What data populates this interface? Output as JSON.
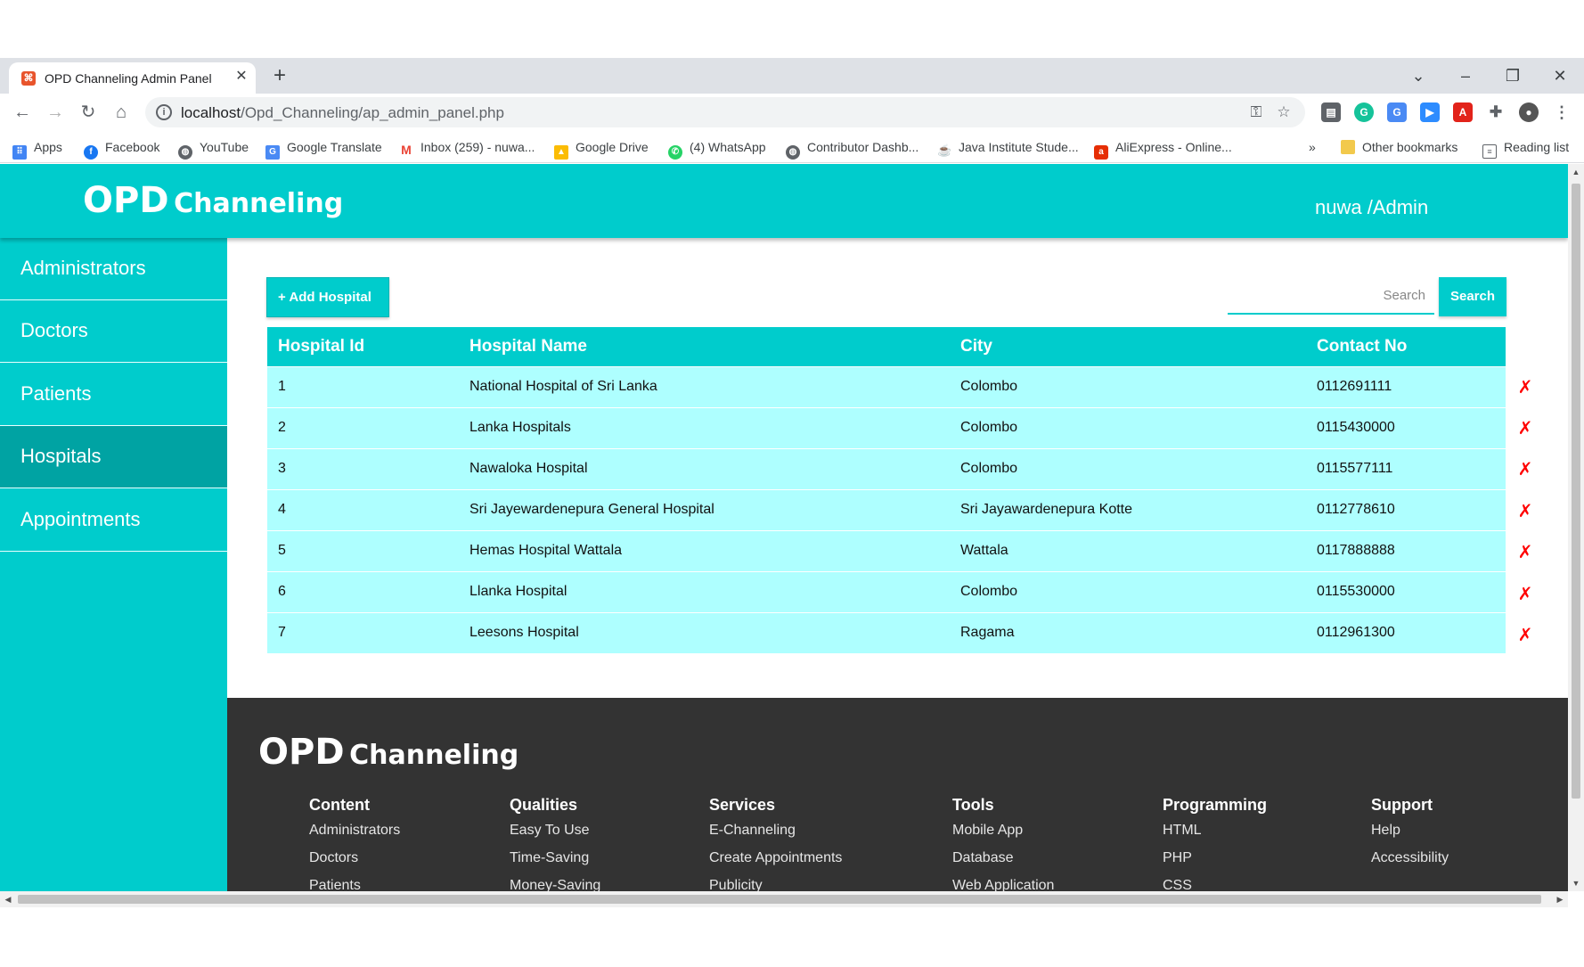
{
  "browser": {
    "tab_title": "OPD Channeling Admin Panel",
    "tab_close": "✕",
    "new_tab": "+",
    "url_host": "localhost",
    "url_path": "/Opd_Channeling/ap_admin_panel.php",
    "bookmarks": [
      {
        "label": "Apps",
        "icon": "apps-icon"
      },
      {
        "label": "Facebook",
        "icon": "facebook-icon"
      },
      {
        "label": "YouTube",
        "icon": "globe-icon"
      },
      {
        "label": "Google Translate",
        "icon": "translate-icon"
      },
      {
        "label": "Inbox (259) - nuwa...",
        "icon": "gmail-icon"
      },
      {
        "label": "Google Drive",
        "icon": "drive-icon"
      },
      {
        "label": "(4) WhatsApp",
        "icon": "whatsapp-icon"
      },
      {
        "label": "Contributor Dashb...",
        "icon": "globe-icon"
      },
      {
        "label": "Java Institute Stude...",
        "icon": "java-icon"
      },
      {
        "label": "AliExpress - Online...",
        "icon": "aliexpress-icon"
      }
    ],
    "more_bookmarks": "»",
    "other_bookmarks": "Other bookmarks",
    "reading_list": "Reading list"
  },
  "header": {
    "brand_main": "OPD",
    "brand_sub": "Channeling",
    "user": "nuwa /Admin"
  },
  "sidebar": {
    "items": [
      {
        "label": "Administrators",
        "active": false
      },
      {
        "label": "Doctors",
        "active": false
      },
      {
        "label": "Patients",
        "active": false
      },
      {
        "label": "Hospitals",
        "active": true
      },
      {
        "label": "Appointments",
        "active": false
      }
    ]
  },
  "main": {
    "add_button": "+ Add Hospital",
    "search_placeholder": "Search",
    "search_button": "Search",
    "delete_symbol": "✗",
    "columns": [
      "Hospital Id",
      "Hospital Name",
      "City",
      "Contact No"
    ],
    "rows": [
      {
        "id": "1",
        "name": "National Hospital of Sri Lanka",
        "city": "Colombo",
        "contact": "0112691111"
      },
      {
        "id": "2",
        "name": "Lanka Hospitals",
        "city": "Colombo",
        "contact": "0115430000"
      },
      {
        "id": "3",
        "name": "Nawaloka Hospital",
        "city": "Colombo",
        "contact": "0115577111"
      },
      {
        "id": "4",
        "name": "Sri Jayewardenepura General Hospital",
        "city": "Sri Jayawardenepura Kotte",
        "contact": "0112778610"
      },
      {
        "id": "5",
        "name": "Hemas Hospital Wattala",
        "city": "Wattala",
        "contact": "0117888888"
      },
      {
        "id": "6",
        "name": "Llanka Hospital",
        "city": "Colombo",
        "contact": "0115530000"
      },
      {
        "id": "7",
        "name": "Leesons Hospital",
        "city": "Ragama",
        "contact": "0112961300"
      }
    ]
  },
  "footer": {
    "brand_main": "OPD",
    "brand_sub": "Channeling",
    "columns": [
      {
        "heading": "Content",
        "links": [
          "Administrators",
          "Doctors",
          "Patients"
        ]
      },
      {
        "heading": "Qualities",
        "links": [
          "Easy To Use",
          "Time-Saving",
          "Money-Saving"
        ]
      },
      {
        "heading": "Services",
        "links": [
          "E-Channeling",
          "Create Appointments",
          "Publicity"
        ]
      },
      {
        "heading": "Tools",
        "links": [
          "Mobile App",
          "Database",
          "Web Application"
        ]
      },
      {
        "heading": "Programming",
        "links": [
          "HTML",
          "PHP",
          "CSS"
        ]
      },
      {
        "heading": "Support",
        "links": [
          "Help",
          "Accessibility"
        ]
      }
    ]
  },
  "colors": {
    "primary": "#00cccc",
    "active_nav": "#00a3a3",
    "row_bg": "#aeffff",
    "footer_bg": "#333333",
    "delete": "#ff0000"
  }
}
